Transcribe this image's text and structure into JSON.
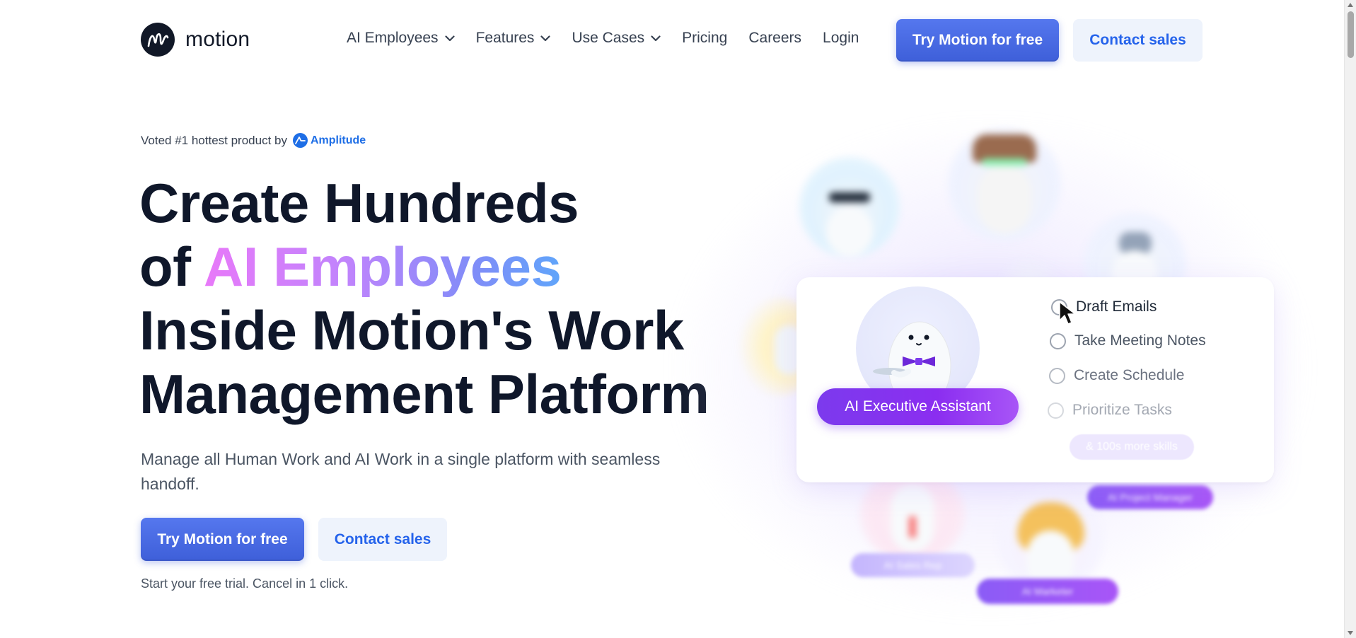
{
  "header": {
    "logo_text": "motion",
    "nav": [
      {
        "label": "AI Employees",
        "dropdown": true
      },
      {
        "label": "Features",
        "dropdown": true
      },
      {
        "label": "Use Cases",
        "dropdown": true
      },
      {
        "label": "Pricing",
        "dropdown": false
      },
      {
        "label": "Careers",
        "dropdown": false
      },
      {
        "label": "Login",
        "dropdown": false
      }
    ],
    "try_label": "Try Motion for free",
    "contact_label": "Contact sales"
  },
  "hero": {
    "voted_prefix": "Voted #1 hottest product by",
    "voted_brand": "Amplitude",
    "headline_line1": "Create Hundreds",
    "headline_line2_prefix": "of ",
    "headline_line2_highlight": "AI Employees",
    "headline_line3": "Inside Motion's Work",
    "headline_line4": "Management Platform",
    "subheading": "Manage all Human Work and AI Work in a single platform with seamless handoff.",
    "try_label": "Try Motion for free",
    "contact_label": "Contact sales",
    "trial_note": "Start your free trial. Cancel in 1 click."
  },
  "illustration": {
    "assistant_label": "AI Executive Assistant",
    "tasks": [
      "Draft Emails",
      "Take Meeting Notes",
      "Create Schedule",
      "Prioritize Tasks"
    ],
    "more_skills": "& 100s more skills",
    "blurred_roles": [
      "AI Project Manager",
      "AI Sales Rep",
      "AI Marketer"
    ]
  },
  "colors": {
    "primary": "#3e5fd9",
    "secondary_bg": "#eef3fc",
    "secondary_text": "#2563eb",
    "assistant_purple": "#7c3aed",
    "headline": "#0f172a"
  }
}
